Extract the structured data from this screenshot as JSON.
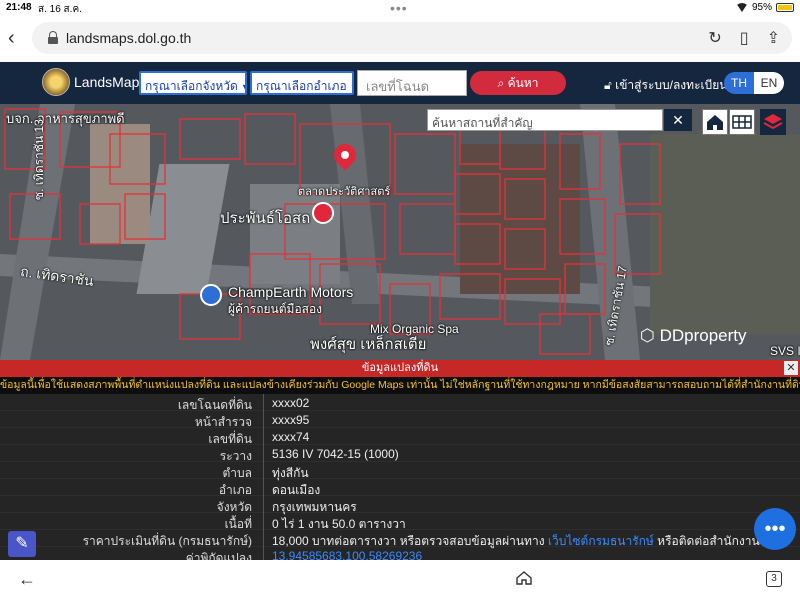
{
  "status_bar": {
    "time": "21:48",
    "date": "ส. 16 ส.ค.",
    "battery": "95%"
  },
  "browser": {
    "url": "landsmaps.dol.go.th",
    "tab_count": "3"
  },
  "header": {
    "app_name": "LandsMaps",
    "province_select": "กรุณาเลือกจังหวัด",
    "district_select": "กรุณาเลือกอำเภอ",
    "deed_placeholder": "เลขที่โฉนด",
    "search_label": "ค้นหา",
    "login_label": "เข้าสู่ระบบ/ลงทะเบียน",
    "lang_th": "TH",
    "lang_en": "EN"
  },
  "map": {
    "place_search_placeholder": "ค้นหาสถานที่สำคัญ",
    "labels": {
      "top_left": "บจก. อาหารสุขภาพดี",
      "pin_area": "ตลาดประวัติศาสตร์",
      "poi_1": "ประพันธ์โอสถ",
      "poi_2": "ChampEarth Motors",
      "poi_2_sub": "ผู้ค้ารถยนต์มือสอง",
      "road_1": "ซ. เทิดราชัน 13",
      "road_2": "ถ. เทิดราชัน",
      "road_3": "ซ. เทิดราชัน 17",
      "bottom_center": "พงศ์สุข เหล็กสเตีย",
      "bottom_center_2": "Mix Organic Spa",
      "watermark": "DDproperty",
      "corner": "SVS I"
    }
  },
  "banner": {
    "title": "ข้อมูลแปลงที่ดิน",
    "close": "✕",
    "notice": "ข้อมูลนี้เพื่อใช้แสดงสภาพพื้นที่ตำแหน่งแปลงที่ดิน และแปลงข้างเคียงร่วมกับ Google Maps เท่านั้น ไม่ใช่หลักฐานที่ใช้ทางกฎหมาย หากมีข้อสงสัยสามารถสอบถามได้ที่สำนักงานที่ดินทุกแห่ง"
  },
  "parcel": {
    "rows": [
      {
        "key": "เลขโฉนดที่ดิน",
        "value": "xxxx02"
      },
      {
        "key": "หน้าสำรวจ",
        "value": "xxxx95"
      },
      {
        "key": "เลขที่ดิน",
        "value": "xxxx74"
      },
      {
        "key": "ระวาง",
        "value": "5136 IV 7042-15 (1000)"
      },
      {
        "key": "ตำบล",
        "value": "ทุ่งสีกัน"
      },
      {
        "key": "อำเภอ",
        "value": "ดอนเมือง"
      },
      {
        "key": "จังหวัด",
        "value": "กรุงเทพมหานคร"
      },
      {
        "key": "เนื้อที่",
        "value": "0 ไร่ 1 งาน 50.0 ตารางวา"
      }
    ],
    "price_key": "ราคาประเมินที่ดิน (กรมธนารักษ์)",
    "price_value": "18,000 บาทต่อตารางวา หรือตรวจสอบข้อมูลผ่านทาง ",
    "price_link": "เว็บไซต์กรมธนารักษ์",
    "price_suffix": " หรือติดต่อสำนักงานที่ดิน",
    "coord_key": "ค่าพิกัดแปลง",
    "coord_value": "13.94585683,100.58269236"
  },
  "colors": {
    "navbar": "#15263f",
    "accent": "#2d6fd6",
    "danger": "#d32b3e",
    "notice": "#f2c230"
  }
}
